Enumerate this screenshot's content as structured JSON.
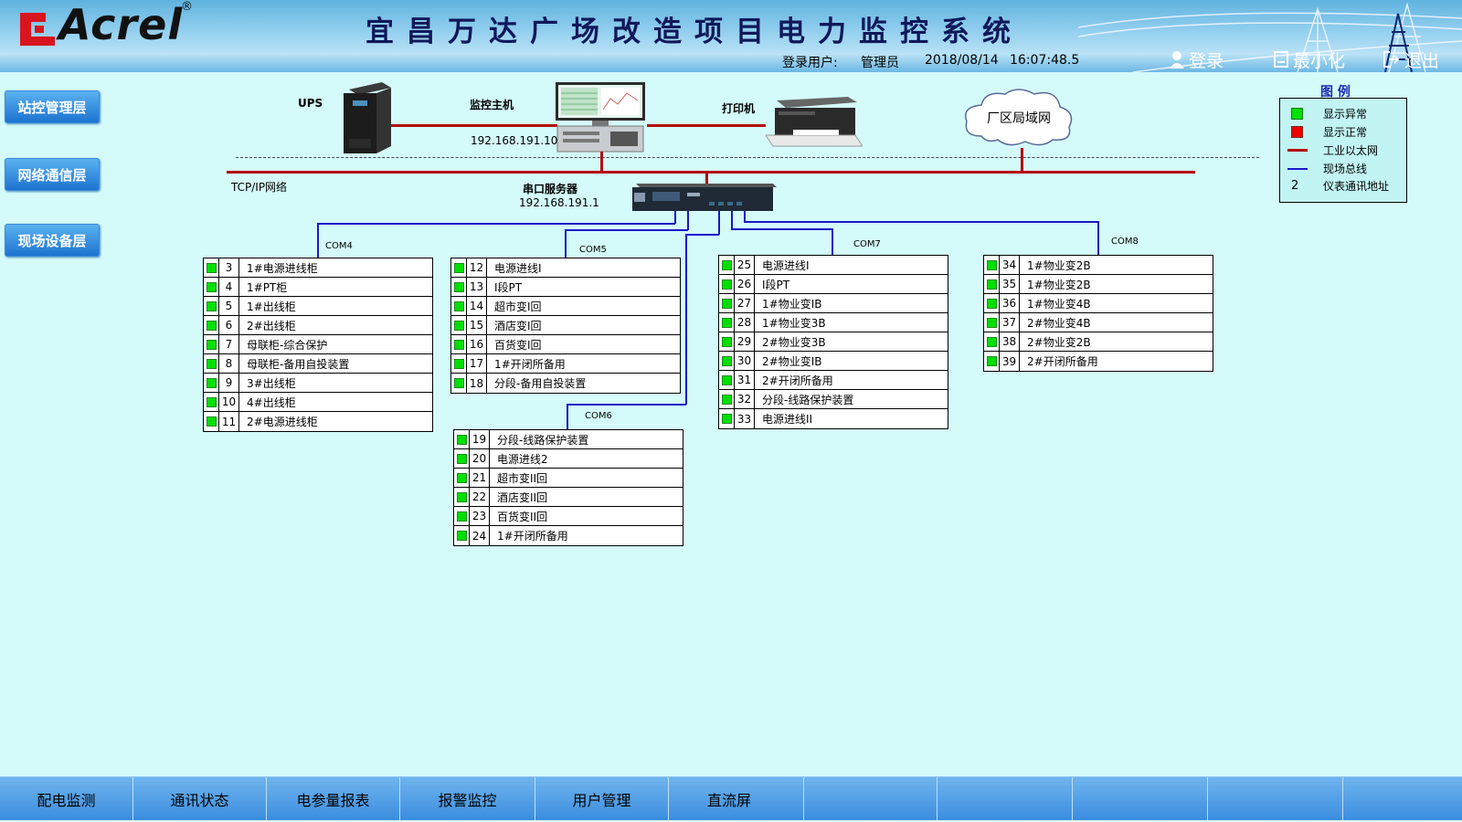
{
  "header": {
    "logo_text": "Acrel",
    "logo_reg": "®",
    "title": "宜昌万达广场改造项目电力监控系统",
    "login_label": "登录用户:",
    "user": "管理员",
    "date": "2018/08/14",
    "time": "16:07:48.5",
    "buttons": [
      {
        "label": "登录",
        "icon": "user-icon"
      },
      {
        "label": "最小化",
        "icon": "minimize-icon"
      },
      {
        "label": "退出",
        "icon": "exit-icon"
      }
    ]
  },
  "left_nav": [
    {
      "label": "站控管理层"
    },
    {
      "label": "网络通信层"
    },
    {
      "label": "现场设备层"
    }
  ],
  "network": {
    "ups_label": "UPS",
    "host_label": "监控主机",
    "host_ip": "192.168.191.10",
    "printer_label": "打印机",
    "lan_label": "厂区局域网",
    "tcpip_label": "TCP/IP网络",
    "serial_label": "串口服务器",
    "serial_ip": "192.168.191.1"
  },
  "coms": [
    {
      "label": "COM4"
    },
    {
      "label": "COM5"
    },
    {
      "label": "COM6"
    },
    {
      "label": "COM7"
    },
    {
      "label": "COM8"
    }
  ],
  "groups": [
    {
      "rows": [
        {
          "num": "3",
          "name": "1#电源进线柜",
          "status": "green"
        },
        {
          "num": "4",
          "name": "1#PT柜",
          "status": "green"
        },
        {
          "num": "5",
          "name": "1#出线柜",
          "status": "green"
        },
        {
          "num": "6",
          "name": "2#出线柜",
          "status": "green"
        },
        {
          "num": "7",
          "name": "母联柜-综合保护",
          "status": "green"
        },
        {
          "num": "8",
          "name": "母联柜-备用自投装置",
          "status": "green"
        },
        {
          "num": "9",
          "name": "3#出线柜",
          "status": "green"
        },
        {
          "num": "10",
          "name": "4#出线柜",
          "status": "green"
        },
        {
          "num": "11",
          "name": "2#电源进线柜",
          "status": "green"
        }
      ]
    },
    {
      "rows": [
        {
          "num": "12",
          "name": "电源进线I",
          "status": "green"
        },
        {
          "num": "13",
          "name": "I段PT",
          "status": "green"
        },
        {
          "num": "14",
          "name": "超市变I回",
          "status": "green"
        },
        {
          "num": "15",
          "name": "酒店变I回",
          "status": "green"
        },
        {
          "num": "16",
          "name": "百货变I回",
          "status": "green"
        },
        {
          "num": "17",
          "name": "1#开闭所备用",
          "status": "green"
        },
        {
          "num": "18",
          "name": "分段-备用自投装置",
          "status": "green"
        }
      ]
    },
    {
      "rows": [
        {
          "num": "19",
          "name": "分段-线路保护装置",
          "status": "green"
        },
        {
          "num": "20",
          "name": "电源进线2",
          "status": "green"
        },
        {
          "num": "21",
          "name": "超市变II回",
          "status": "green"
        },
        {
          "num": "22",
          "name": "酒店变II回",
          "status": "green"
        },
        {
          "num": "23",
          "name": "百货变II回",
          "status": "green"
        },
        {
          "num": "24",
          "name": "1#开闭所备用",
          "status": "green"
        }
      ]
    },
    {
      "rows": [
        {
          "num": "25",
          "name": "电源进线I",
          "status": "green"
        },
        {
          "num": "26",
          "name": "I段PT",
          "status": "green"
        },
        {
          "num": "27",
          "name": "1#物业变IB",
          "status": "green"
        },
        {
          "num": "28",
          "name": "1#物业变3B",
          "status": "green"
        },
        {
          "num": "29",
          "name": "2#物业变3B",
          "status": "green"
        },
        {
          "num": "30",
          "name": "2#物业变IB",
          "status": "green"
        },
        {
          "num": "31",
          "name": "2#开闭所备用",
          "status": "green"
        },
        {
          "num": "32",
          "name": "分段-线路保护装置",
          "status": "green"
        },
        {
          "num": "33",
          "name": "电源进线II",
          "status": "green"
        }
      ]
    },
    {
      "rows": [
        {
          "num": "34",
          "name": "1#物业变2B",
          "status": "green"
        },
        {
          "num": "35",
          "name": "1#物业变2B",
          "status": "green"
        },
        {
          "num": "36",
          "name": "1#物业变4B",
          "status": "green"
        },
        {
          "num": "37",
          "name": "2#物业变4B",
          "status": "green"
        },
        {
          "num": "38",
          "name": "2#物业变2B",
          "status": "green"
        },
        {
          "num": "39",
          "name": "2#开闭所备用",
          "status": "green"
        }
      ]
    }
  ],
  "legend": {
    "title": "图 例",
    "items": [
      {
        "symbol": "green-square",
        "label": "显示异常"
      },
      {
        "symbol": "red-square",
        "label": "显示正常"
      },
      {
        "symbol": "red-line",
        "label": "工业以太网"
      },
      {
        "symbol": "blue-line",
        "label": "现场总线"
      },
      {
        "symbol": "2",
        "label": "仪表通讯地址"
      }
    ]
  },
  "colors": {
    "status_green": "#00e000",
    "status_red": "#ee0000",
    "ethernet": "#b40d0d",
    "fieldbus": "#1818c8"
  },
  "bottom_tabs": [
    {
      "label": "配电监测"
    },
    {
      "label": "通讯状态"
    },
    {
      "label": "电参量报表"
    },
    {
      "label": "报警监控"
    },
    {
      "label": "用户管理"
    },
    {
      "label": "直流屏"
    },
    {
      "label": ""
    },
    {
      "label": ""
    },
    {
      "label": ""
    },
    {
      "label": ""
    },
    {
      "label": ""
    }
  ]
}
